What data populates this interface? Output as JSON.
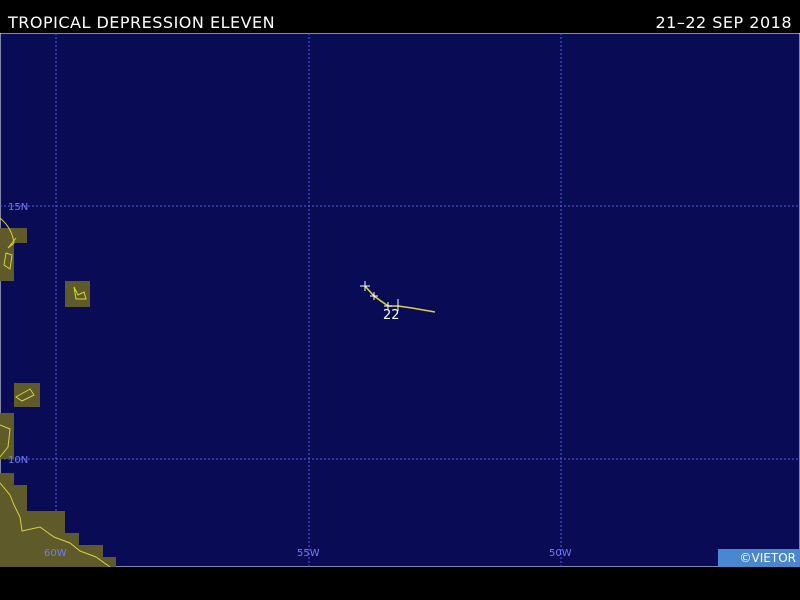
{
  "header": {
    "title": "TROPICAL DEPRESSION ELEVEN",
    "dates": "21–22 SEP 2018"
  },
  "map": {
    "latitude_labels": [
      "15N",
      "10N"
    ],
    "longitude_labels": [
      "60W",
      "55W",
      "50W"
    ],
    "track_day_label": "22",
    "colors": {
      "ocean": "#0a0b55",
      "land": "#5f5a2a",
      "coast": "#d8d23c",
      "grid": "#4f5fe6",
      "track": "#d8d23c"
    }
  },
  "credit": "©VIETOR"
}
